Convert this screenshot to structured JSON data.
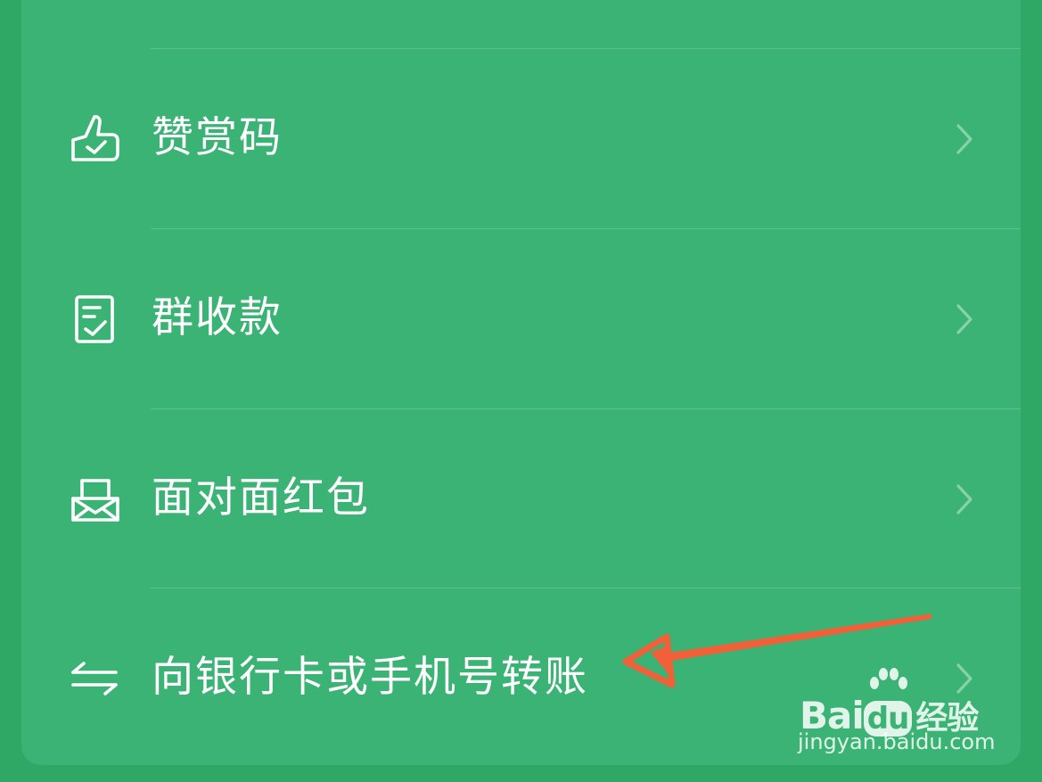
{
  "menu": {
    "items": [
      {
        "label": "赞赏码",
        "icon": "thumbs-up-icon"
      },
      {
        "label": "群收款",
        "icon": "bill-check-icon"
      },
      {
        "label": "面对面红包",
        "icon": "red-packet-icon"
      },
      {
        "label": "向银行卡或手机号转账",
        "icon": "transfer-arrows-icon"
      }
    ]
  },
  "annotation": {
    "arrow_color": "#f0613a"
  },
  "watermark": {
    "logo_bai": "Bai",
    "logo_du": "du",
    "logo_jingyan": "经验",
    "url": "jingyan.baidu.com"
  },
  "colors": {
    "background": "#2fa865",
    "panel": "#3ab374",
    "text": "#ffffff"
  }
}
